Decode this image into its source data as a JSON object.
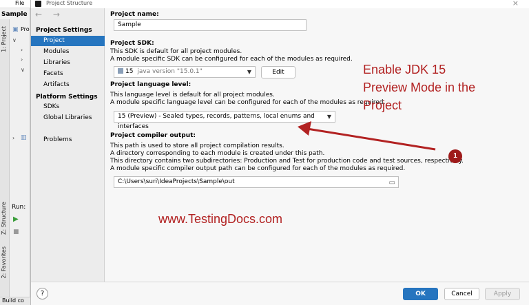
{
  "ide": {
    "menu_file": "File",
    "project_tab": "Sample",
    "tree_root": "Pro",
    "side_tabs": [
      "1: Project",
      "Z: Structure",
      "2: Favorites"
    ],
    "run_label": "Run:",
    "build_label": "Build co"
  },
  "dialog": {
    "title": "Project Structure",
    "close": "×",
    "nav_arrows": "← →",
    "sidebar": {
      "project_settings": "Project Settings",
      "items": [
        "Project",
        "Modules",
        "Libraries",
        "Facets",
        "Artifacts"
      ],
      "platform_settings": "Platform Settings",
      "platform_items": [
        "SDKs",
        "Global Libraries"
      ],
      "problems": "Problems"
    },
    "content": {
      "name_label": "Project name:",
      "name_value": "Sample",
      "sdk_label": "Project SDK:",
      "sdk_desc1": "This SDK is default for all project modules.",
      "sdk_desc2": "A module specific SDK can be configured for each of the modules as required.",
      "sdk_value": "15",
      "sdk_version": "java version \"15.0.1\"",
      "sdk_edit": "Edit",
      "lang_label": "Project language level:",
      "lang_desc1": "This language level is default for all project modules.",
      "lang_desc2": "A module specific language level can be configured for each of the modules as required.",
      "lang_value": "15 (Preview) - Sealed types, records, patterns, local enums and interfaces",
      "out_label": "Project compiler output:",
      "out_desc1": "This path is used to store all project compilation results.",
      "out_desc2": "A directory corresponding to each module is created under this path.",
      "out_desc3": "This directory contains two subdirectories: Production and Test for production code and test sources, respectively.",
      "out_desc4": "A module specific compiler output path can be configured for each of the modules as required.",
      "out_value": "C:\\Users\\suri\\IdeaProjects\\Sample\\out"
    },
    "footer": {
      "help": "?",
      "ok": "OK",
      "cancel": "Cancel",
      "apply": "Apply"
    }
  },
  "annotation": {
    "lines": [
      "Enable JDK 15",
      "Preview Mode in the",
      "Project"
    ],
    "badge": "1",
    "watermark": "www.TestingDocs.com",
    "color": "#b22222"
  },
  "colors": {
    "accent": "#2675bf"
  }
}
